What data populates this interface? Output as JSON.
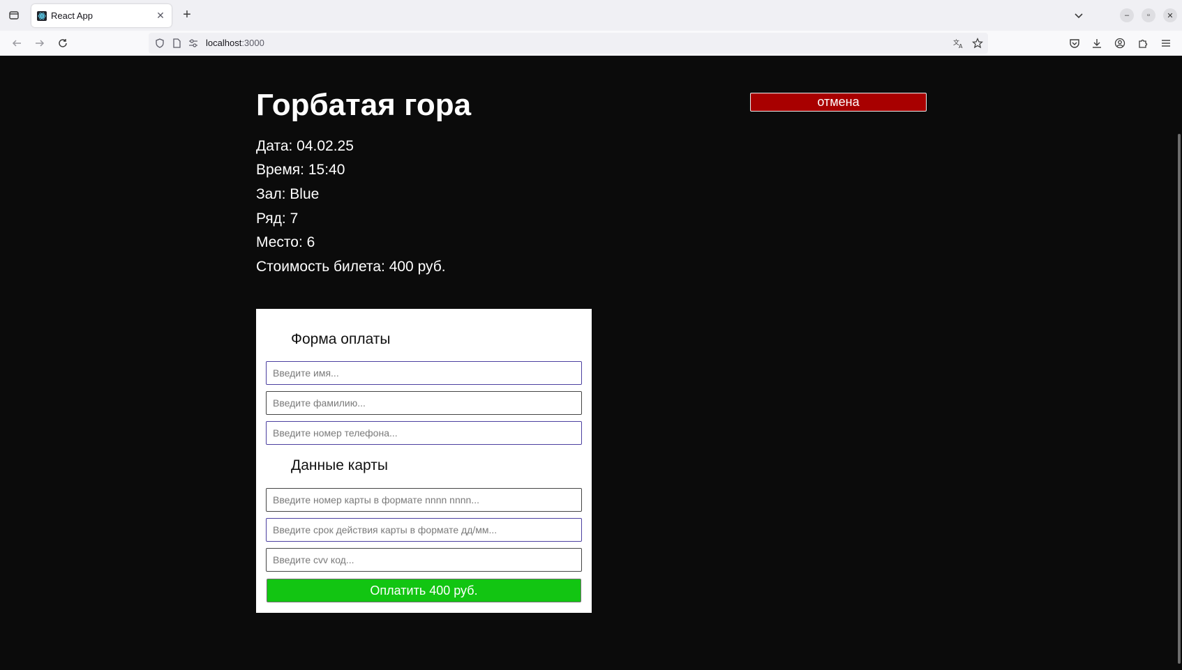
{
  "browser": {
    "tab_title": "React App",
    "url_host": "localhost",
    "url_port": ":3000"
  },
  "movie": {
    "title": "Горбатая гора",
    "date": "Дата: 04.02.25",
    "time": "Время: 15:40",
    "hall": "Зал: Blue",
    "row": "Ряд: 7",
    "seat": "Место: 6",
    "price": "Стоимость билета: 400 руб."
  },
  "cancel_label": "отмена",
  "payment_form": {
    "heading": "Форма оплаты",
    "first_name_placeholder": "Введите имя...",
    "last_name_placeholder": "Введите фамилию...",
    "phone_placeholder": "Введите номер телефона...",
    "card_heading": "Данные карты",
    "card_number_placeholder": "Введите номер карты в формате nnnn nnnn...",
    "card_expiry_placeholder": "Введите срок действия карты в формате дд/мм...",
    "cvv_placeholder": "Введите cvv код...",
    "pay_label": "Оплатить 400 руб."
  },
  "colors": {
    "page_bg": "#0b0b0b",
    "cancel_bg": "#a80000",
    "pay_bg": "#12c512",
    "input_border": "#4b3fa0"
  }
}
